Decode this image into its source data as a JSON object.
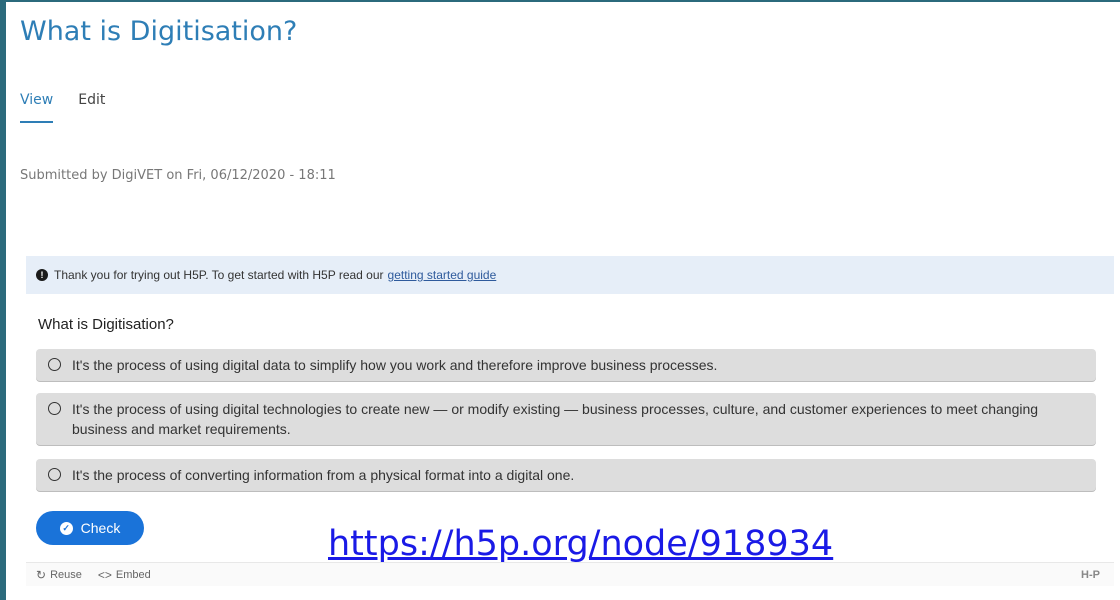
{
  "page": {
    "title": "What is Digitisation?",
    "tabs": [
      {
        "label": "View",
        "active": true
      },
      {
        "label": "Edit",
        "active": false
      }
    ],
    "submitted": "Submitted by DigiVET on Fri, 06/12/2020 - 18:11"
  },
  "notice": {
    "icon": "info-icon",
    "text": "Thank you for trying out H5P. To get started with H5P read our",
    "link": "getting started guide"
  },
  "quiz": {
    "question": "What is Digitisation?",
    "answers": [
      "It's the process of using digital data to simplify how you work and therefore improve business processes.",
      "It's the process of using digital technologies to create new — or modify existing — business processes, culture, and customer experiences to meet changing business and market requirements.",
      "It's the process of converting information from a physical format into a digital one."
    ],
    "check_label": "Check"
  },
  "overlay_url": "https://h5p.org/node/918934",
  "footer": {
    "reuse_label": "Reuse",
    "embed_label": "Embed",
    "logo": "H-P"
  },
  "colors": {
    "accent": "#2e7eb6",
    "check_button": "#1a73d9",
    "notice_bg": "#e6eef8",
    "answer_bg": "#dddddd"
  }
}
